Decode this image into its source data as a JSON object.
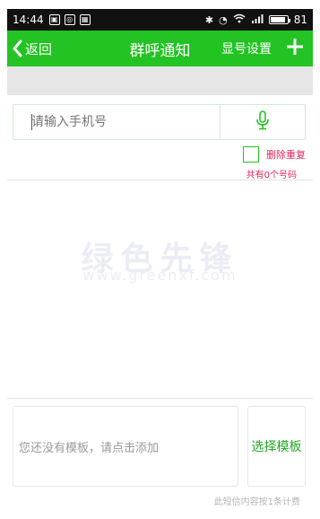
{
  "status_bar": {
    "time": "14:44",
    "battery": "81",
    "icons": [
      "app-notification-icon",
      "weibo-icon",
      "image-icon",
      "bluetooth-icon",
      "alarm-icon",
      "wifi-icon",
      "signal-icon",
      "battery-icon"
    ]
  },
  "header": {
    "back_label": "返回",
    "title": "群呼通知",
    "display_number_label": "显号设置",
    "add_icon": "plus-icon",
    "accent_color": "#22c322"
  },
  "phone_input": {
    "placeholder": "请输入手机号",
    "mic_icon": "microphone-icon"
  },
  "dedupe": {
    "label": "删除重复",
    "checked": false,
    "count_text": "共有0个号码"
  },
  "watermark": {
    "main": "绿色先锋",
    "sub": "www.greenxf.com"
  },
  "template": {
    "placeholder": "您还没有模板，请点击添加",
    "choose_label": "选择模板",
    "billing_note": "此短信内容按1条计费"
  }
}
